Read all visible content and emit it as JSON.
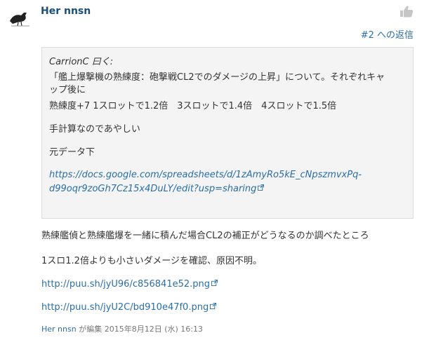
{
  "post": {
    "username": "Her nnsn",
    "reply_link": "#2 への返信"
  },
  "quote": {
    "header": "CarrionC 曰く:",
    "line1": "「艦上爆撃機の熟練度：砲撃戦CL2でのダメージの上昇」について。それぞれキャ",
    "line2": "ップ後に",
    "line3": "熟練度+7 1スロットで1.2倍　3スロットで1.4倍　4スロットで1.5倍",
    "line4": "手計算なのであやしい",
    "line5": "元データ下",
    "link_line1": "https://docs.google.com/spreadsheets/d/1zAmyRo5kE_cNpszmvxPq-",
    "link_line2": "d99oqr9zoGh7Cz15x4DuLY/edit?usp=sharing"
  },
  "body": {
    "para1": "熟練艦偵と熟練艦爆を一緒に積んだ場合CL2の補正がどうなるのか調べたところ",
    "para2": "1スロ1.2倍よりも小さいダメージを確認、原因不明。",
    "link1": "http://puu.sh/jyU96/c856841e52.png",
    "link2": "http://puu.sh/jyU2C/bd910e47f0.png"
  },
  "footer": {
    "editor": "Her nnsn",
    "edited_text": "が編集",
    "timestamp": "2015年8月12日 (水) 16:13"
  },
  "colors": {
    "link": "#2a6ea6",
    "username": "#1a4f78",
    "quote_bg": "#f4f4f4"
  },
  "icons": [
    "crow-avatar-icon",
    "thumbs-up-icon",
    "external-link-icon"
  ]
}
